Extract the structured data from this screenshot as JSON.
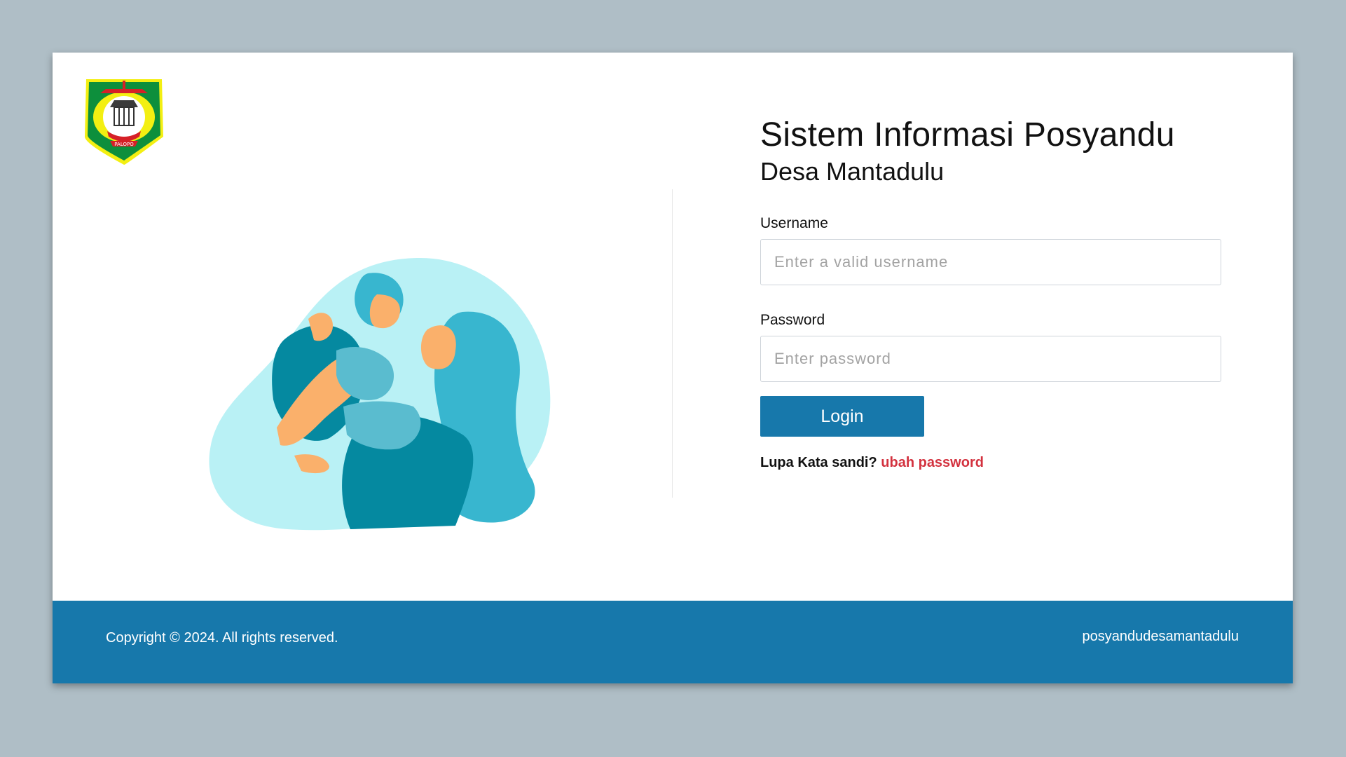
{
  "header": {
    "logo_text": "PALOPO"
  },
  "login": {
    "title": "Sistem Informasi Posyandu",
    "subtitle": "Desa Mantadulu",
    "username_label": "Username",
    "username_placeholder": "Enter a valid username",
    "password_label": "Password",
    "password_placeholder": "Enter password",
    "login_button": "Login",
    "forgot_text": "Lupa Kata sandi?",
    "forgot_link": "ubah password"
  },
  "footer": {
    "copyright": "Copyright © 2024. All rights reserved.",
    "site_name": "posyandudesamantadulu"
  },
  "colors": {
    "background": "#afbec6",
    "primary": "#1778ab",
    "link_red": "#d3323f",
    "illustration_light": "#b9f1f5",
    "illustration_dark": "#0589a0",
    "illustration_mid": "#38b6cf",
    "skin": "#fab06b"
  },
  "icons": {
    "logo": "palopo-emblem-icon",
    "illustration": "mother-and-child-illustration"
  }
}
